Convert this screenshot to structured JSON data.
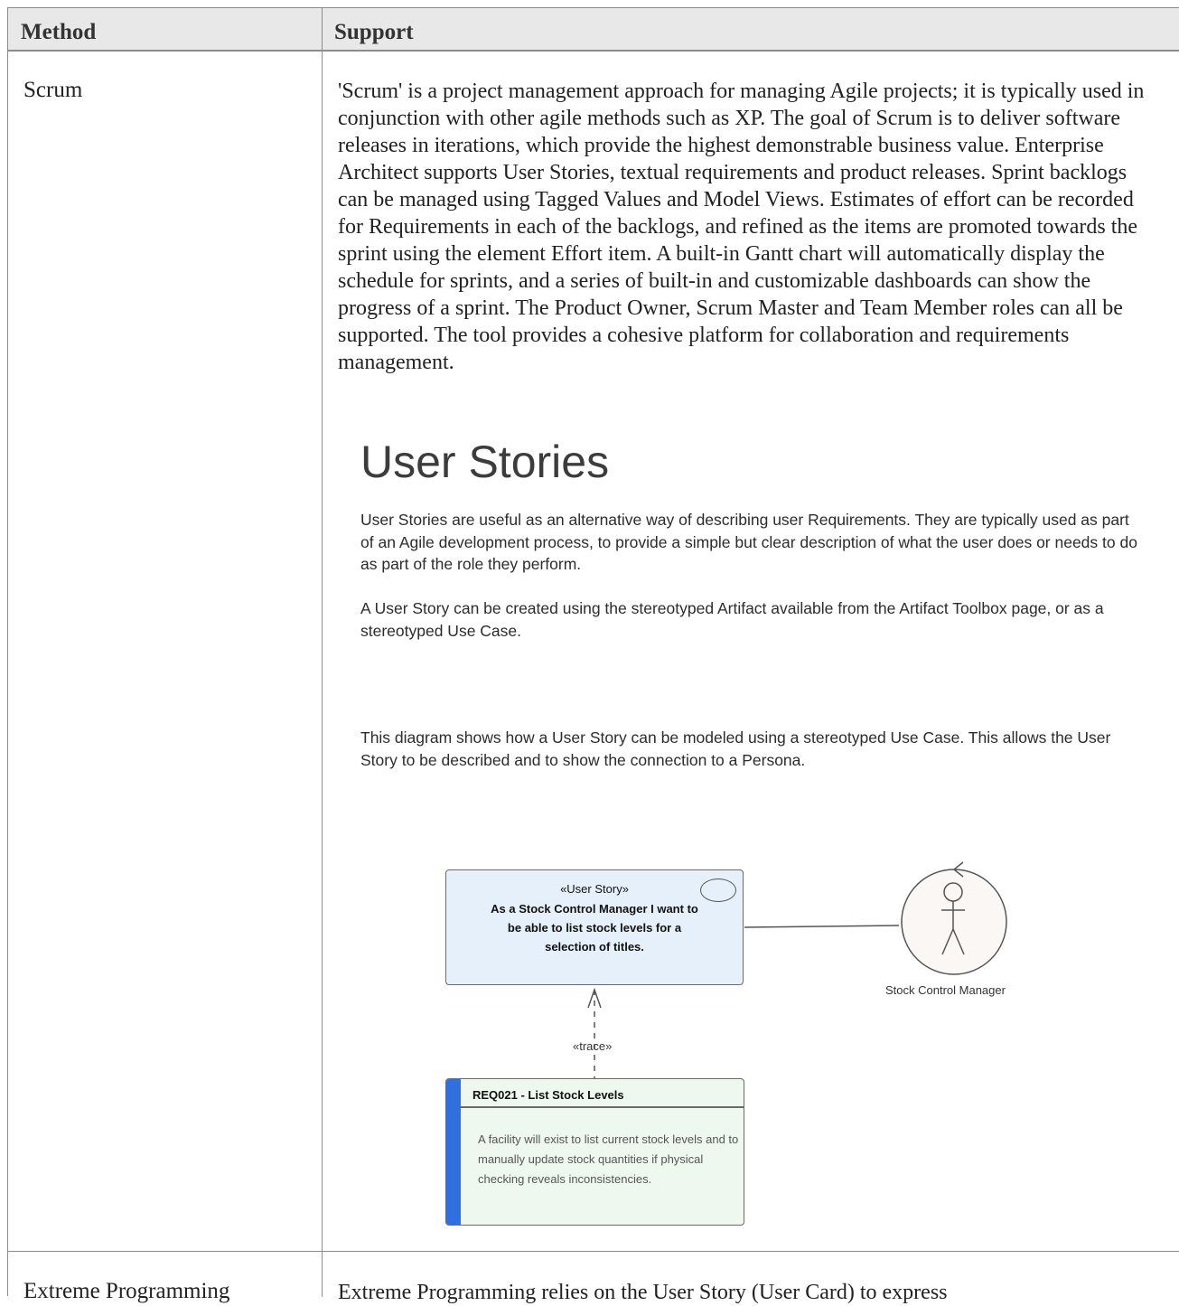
{
  "table": {
    "headers": {
      "method": "Method",
      "support": "Support"
    },
    "rows": [
      {
        "method": "Scrum",
        "support": "'Scrum' is a project management approach for managing Agile projects; it is typically used in conjunction with other agile methods such as XP. The goal of Scrum is to deliver software releases in iterations, which provide the highest demonstrable business value. Enterprise Architect supports User Stories, textual requirements and product releases. Sprint backlogs can be managed using Tagged Values and Model Views. Estimates of effort can be recorded for Requirements in each of the backlogs, and refined as the items are promoted towards the sprint using the element Effort item. A built-in Gantt chart will automatically display the schedule for sprints, and a series of built-in and customizable dashboards can show the progress of a sprint. The Product Owner, Scrum Master and Team Member roles can all be supported. The tool provides a cohesive platform for collaboration and requirements management."
      },
      {
        "method": "Extreme Programming",
        "support": "Extreme Programming relies on the User Story (User Card) to express"
      }
    ]
  },
  "diagram": {
    "title": "User Stories",
    "para1": "User Stories are useful as an alternative way of describing user Requirements.  They are typically used as part of an Agile development process, to provide a simple but clear description of what the user does or needs to do as part of the role they perform.",
    "para2": "A User Story can be created using the stereotyped Artifact available from the Artifact Toolbox page, or as a stereotyped Use Case.",
    "para3": "This diagram shows how a User Story can be modeled using a stereotyped Use Case.  This allows the User Story to be described and to show the connection to a Persona.",
    "story": {
      "stereotype": "«User Story»",
      "text": "As a Stock Control Manager I want to be able to list stock levels for a selection of titles."
    },
    "actor": {
      "label": "Stock Control Manager"
    },
    "trace_label": "«trace»",
    "requirement": {
      "title": "REQ021 - List Stock Levels",
      "body": "A facility will exist to list current stock levels and to manually update stock quantities if physical checking reveals inconsistencies."
    },
    "colors": {
      "story_fill": "#e6f0fb",
      "requirement_fill": "#eef8ee",
      "requirement_bar": "#2f6fe0",
      "actor_fill": "#fbf7f5"
    }
  }
}
